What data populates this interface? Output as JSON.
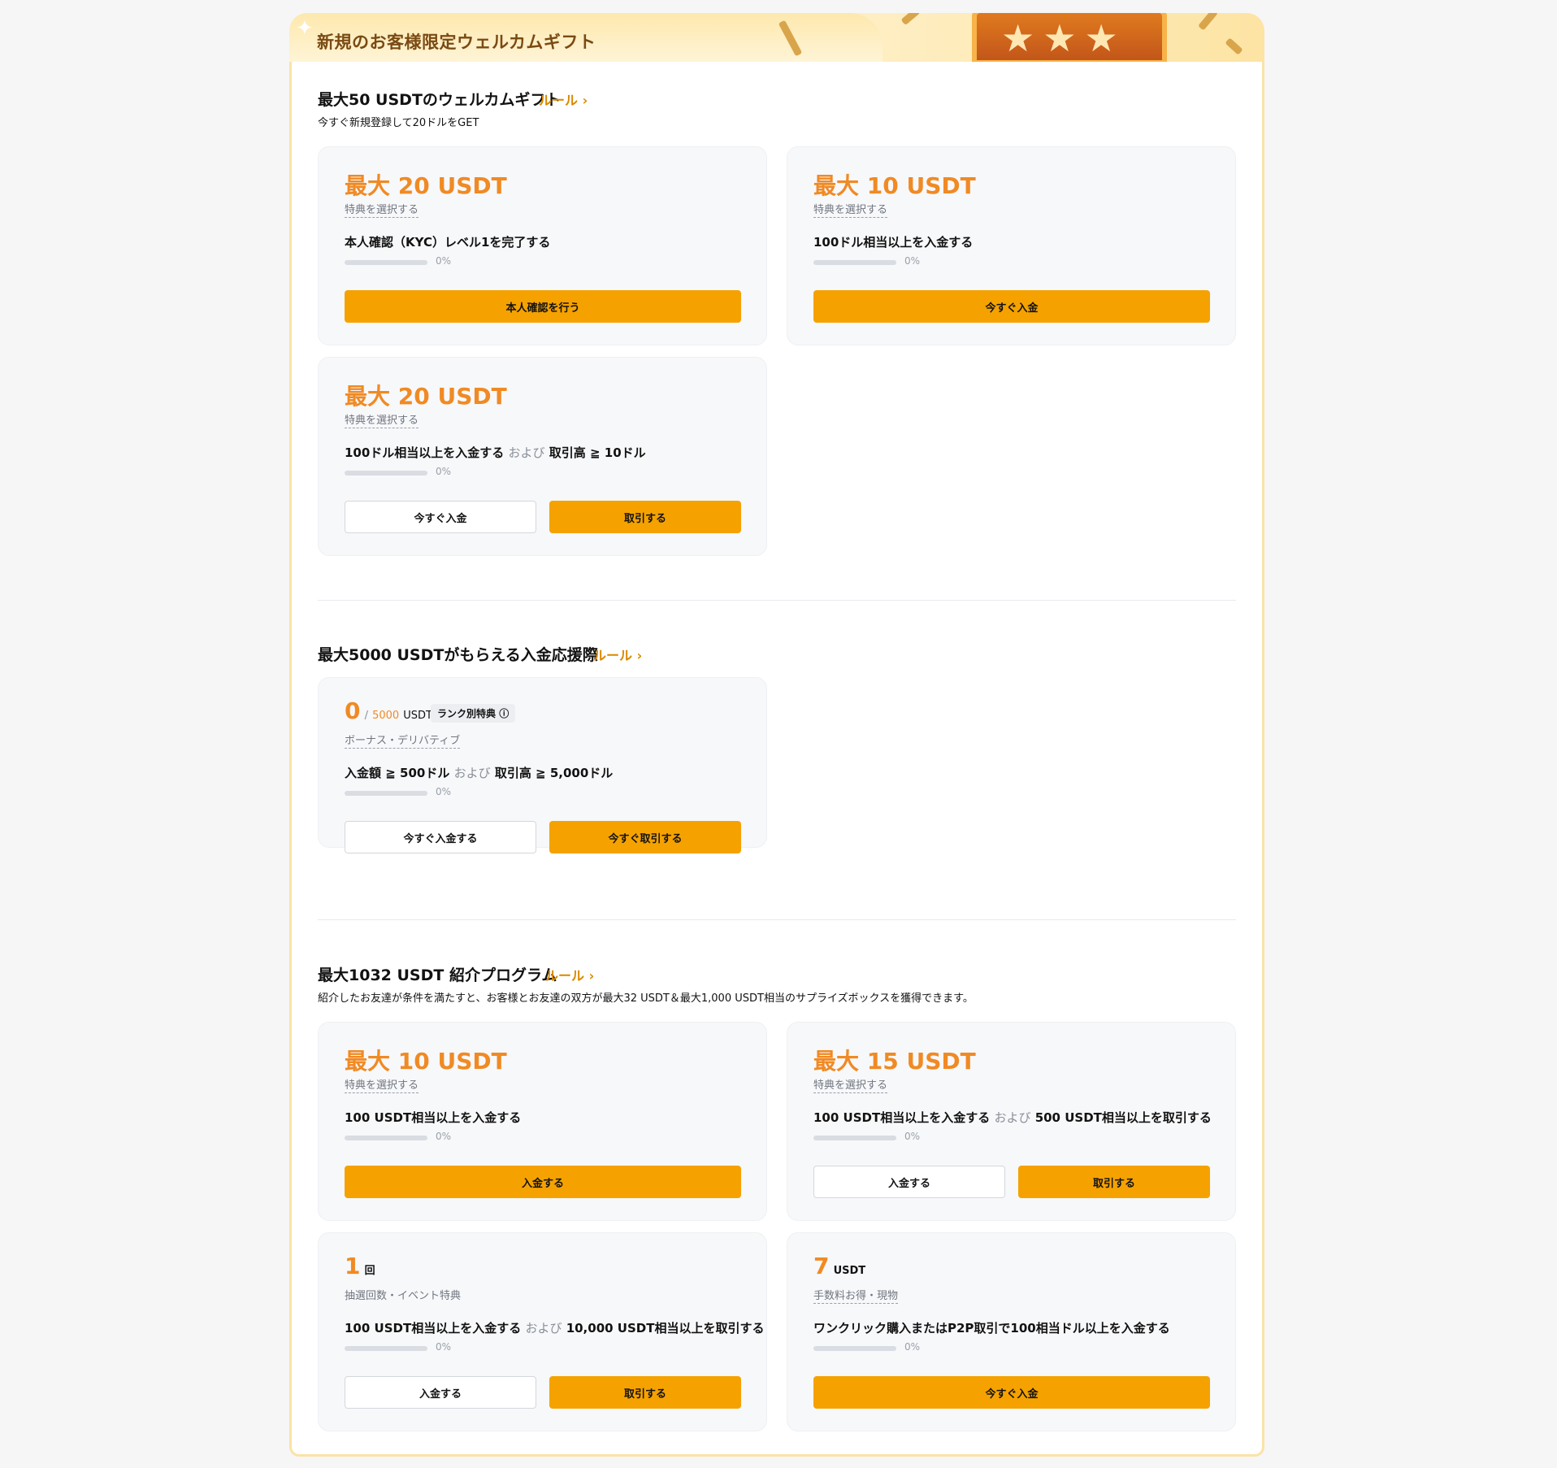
{
  "banner": {
    "title": "新規のお客様限定ウェルカムギフト"
  },
  "colors": {
    "accent": "#f5a200",
    "reward": "#f08a24",
    "link": "#d98a00"
  },
  "section1": {
    "title": "最大50 USDTのウェルカムギフト",
    "rules": "ルール",
    "desc": "今すぐ新規登録して20ドルをGET",
    "cards": [
      {
        "reward": "最大 20 USDT",
        "tag": "特典を選択する",
        "task": "本人確認（KYC）レベル1を完了する",
        "pct": "0%",
        "btn": "本人確認を行う"
      },
      {
        "reward": "最大 10 USDT",
        "tag": "特典を選択する",
        "task": "100ドル相当以上を入金する",
        "pct": "0%",
        "btn": "今すぐ入金"
      },
      {
        "reward": "最大 20 USDT",
        "tag": "特典を選択する",
        "task_a": "100ドル相当以上を入金する",
        "conj": "および",
        "task_b": "取引高 ≧ 10ドル",
        "pct": "0%",
        "btn_left": "今すぐ入金",
        "btn_right": "取引する"
      }
    ]
  },
  "section2": {
    "title": "最大5000 USDTがもらえる入金応援際",
    "rules": "ルール",
    "card": {
      "current": "0",
      "sep": "/",
      "total": "5000",
      "unit": "USDT",
      "badge": "ランク別特典",
      "tag": "ボーナス・デリバティブ",
      "task_a": "入金額 ≧ 500ドル",
      "conj": "および",
      "task_b": "取引高 ≧ 5,000ドル",
      "pct": "0%",
      "btn_left": "今すぐ入金する",
      "btn_right": "今すぐ取引する"
    }
  },
  "section3": {
    "title": "最大1032 USDT 紹介プログラム",
    "rules": "ルール",
    "desc": "紹介したお友達が条件を満たすと、お客様とお友達の双方が最大32 USDT＆最大1,000 USDT相当のサプライズボックスを獲得できます。",
    "cards": [
      {
        "reward": "最大 10 USDT",
        "tag": "特典を選択する",
        "task": "100 USDT相当以上を入金する",
        "pct": "0%",
        "btn": "入金する"
      },
      {
        "reward": "最大 15 USDT",
        "tag": "特典を選択する",
        "task_a": "100 USDT相当以上を入金する",
        "conj": "および",
        "task_b": "500 USDT相当以上を取引する",
        "pct": "0%",
        "btn_left": "入金する",
        "btn_right": "取引する"
      },
      {
        "big": "1",
        "unit": "回",
        "tag": "抽選回数・イベント特典",
        "task_a": "100 USDT相当以上を入金する",
        "conj": "および",
        "task_b": "10,000 USDT相当以上を取引する",
        "pct": "0%",
        "btn_left": "入金する",
        "btn_right": "取引する"
      },
      {
        "big": "7",
        "unit": "USDT",
        "tag": "手数料お得・現物",
        "task": "ワンクリック購入またはP2P取引で100相当ドル以上を入金する",
        "pct": "0%",
        "btn": "今すぐ入金"
      }
    ]
  }
}
